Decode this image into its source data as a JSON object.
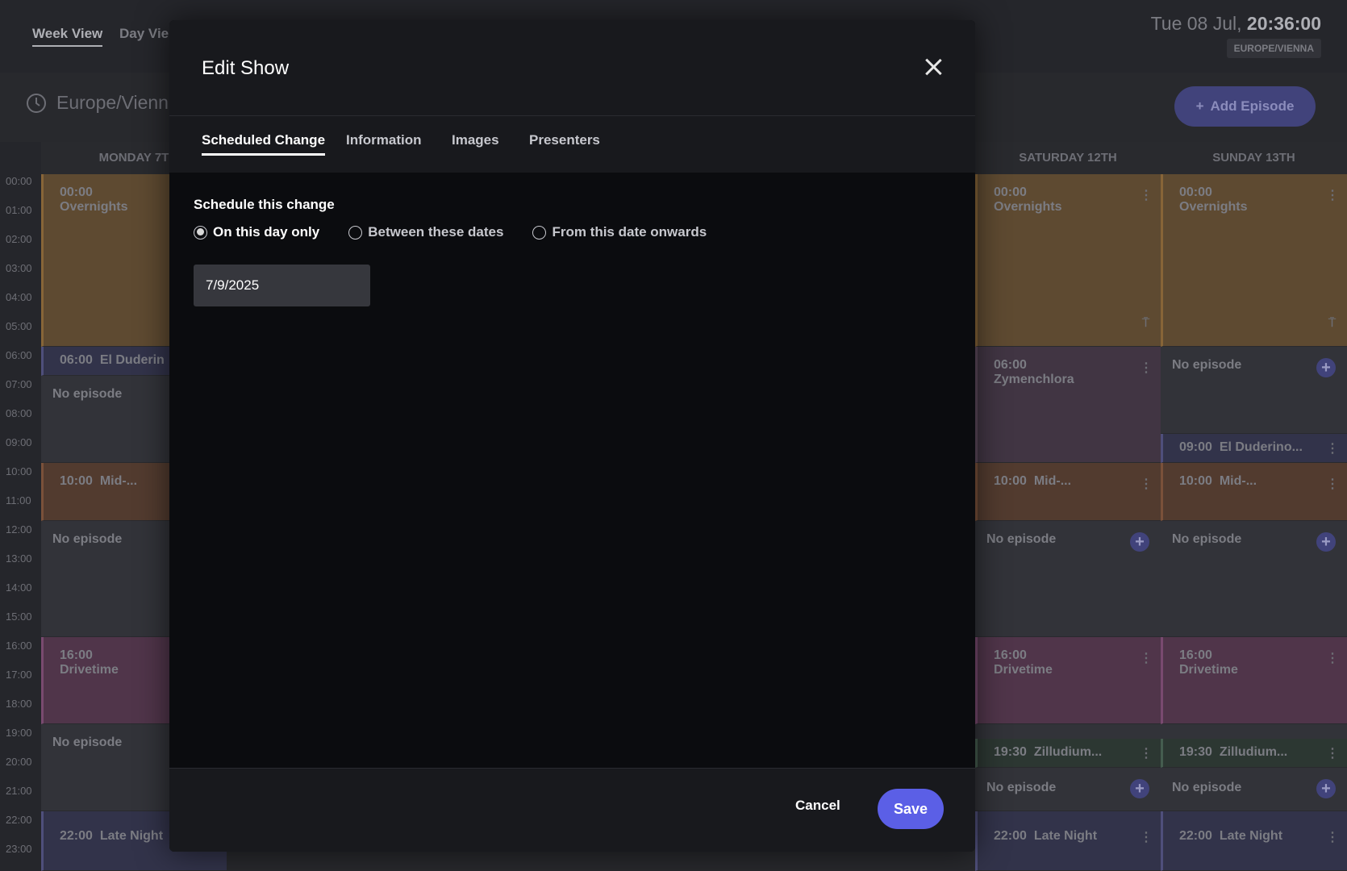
{
  "topbar": {
    "tabs": [
      "Week View",
      "Day Vie"
    ],
    "date_text": "Tue 08 Jul,",
    "time_text": "20:36:00",
    "timezone_badge": "EUROPE/VIENNA",
    "timezone_label": "Europe/Vienna",
    "add_episode_label": "Add Episode"
  },
  "hours": [
    "00:00",
    "01:00",
    "02:00",
    "03:00",
    "04:00",
    "05:00",
    "06:00",
    "07:00",
    "08:00",
    "09:00",
    "10:00",
    "11:00",
    "12:00",
    "13:00",
    "14:00",
    "15:00",
    "16:00",
    "17:00",
    "18:00",
    "19:00",
    "20:00",
    "21:00",
    "22:00",
    "23:00"
  ],
  "days": {
    "monday": {
      "header": "MONDAY 7T",
      "slots": [
        {
          "time": "00:00",
          "title": "Overnights"
        },
        {
          "time": "06:00",
          "title": "El Duderin"
        },
        {
          "time": "",
          "title": "No episode"
        },
        {
          "time": "10:00",
          "title": "Mid-..."
        },
        {
          "time": "",
          "title": "No episode"
        },
        {
          "time": "16:00",
          "title": "Drivetime"
        },
        {
          "time": "",
          "title": "No episode"
        },
        {
          "time": "22:00",
          "title": "Late Night"
        }
      ]
    },
    "saturday": {
      "header": "SATURDAY 12TH",
      "slots": [
        {
          "time": "00:00",
          "title": "Overnights"
        },
        {
          "time": "06:00",
          "title": "Zymenchlora"
        },
        {
          "time": "10:00",
          "title": "Mid-..."
        },
        {
          "time": "",
          "title": "No episode"
        },
        {
          "time": "16:00",
          "title": "Drivetime"
        },
        {
          "time": "19:30",
          "title": "Zilludium..."
        },
        {
          "time": "",
          "title": "No episode"
        },
        {
          "time": "22:00",
          "title": "Late Night"
        }
      ]
    },
    "sunday": {
      "header": "SUNDAY 13TH",
      "slots": [
        {
          "time": "00:00",
          "title": "Overnights"
        },
        {
          "time": "",
          "title": "No episode"
        },
        {
          "time": "09:00",
          "title": "El Duderino..."
        },
        {
          "time": "10:00",
          "title": "Mid-..."
        },
        {
          "time": "",
          "title": "No episode"
        },
        {
          "time": "16:00",
          "title": "Drivetime"
        },
        {
          "time": "19:30",
          "title": "Zilludium..."
        },
        {
          "time": "",
          "title": "No episode"
        },
        {
          "time": "22:00",
          "title": "Late Night"
        }
      ]
    }
  },
  "modal": {
    "title": "Edit Show",
    "tabs": [
      "Scheduled Change",
      "Information",
      "Images",
      "Presenters"
    ],
    "active_tab": "Scheduled Change",
    "section_title": "Schedule this change",
    "options": [
      "On this day only",
      "Between these dates",
      "From this date onwards"
    ],
    "selected_option": "On this day only",
    "date_value": "7/9/2025",
    "cancel_label": "Cancel",
    "save_label": "Save"
  },
  "colors": {
    "accent": "#5b5fe6",
    "modal_bg": "#0b0c0f",
    "modal_header_bg": "#18191d"
  }
}
